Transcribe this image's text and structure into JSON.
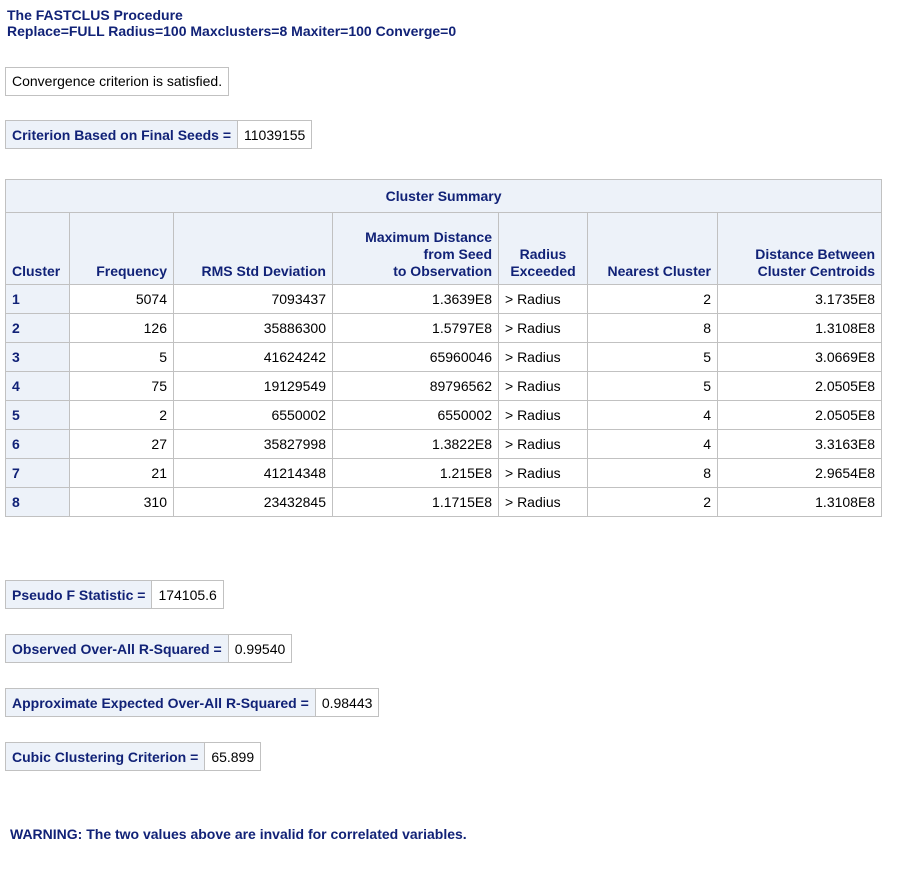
{
  "header": {
    "title": "The FASTCLUS Procedure",
    "options": "Replace=FULL Radius=100 Maxclusters=8 Maxiter=100 Converge=0"
  },
  "convergence_note": "Convergence criterion is satisfied.",
  "criterion_final_seeds": {
    "label": "Criterion Based on Final Seeds =",
    "value": "11039155"
  },
  "cluster_summary": {
    "caption": "Cluster Summary",
    "columns": [
      "Cluster",
      "Frequency",
      "RMS Std Deviation",
      "Maximum Distance\nfrom Seed\nto Observation",
      "Radius\nExceeded",
      "Nearest Cluster",
      "Distance Between\nCluster Centroids"
    ],
    "rows": [
      [
        "1",
        "5074",
        "7093437",
        "1.3639E8",
        "> Radius",
        "2",
        "3.1735E8"
      ],
      [
        "2",
        "126",
        "35886300",
        "1.5797E8",
        "> Radius",
        "8",
        "1.3108E8"
      ],
      [
        "3",
        "5",
        "41624242",
        "65960046",
        "> Radius",
        "5",
        "3.0669E8"
      ],
      [
        "4",
        "75",
        "19129549",
        "89796562",
        "> Radius",
        "5",
        "2.0505E8"
      ],
      [
        "5",
        "2",
        "6550002",
        "6550002",
        "> Radius",
        "4",
        "2.0505E8"
      ],
      [
        "6",
        "27",
        "35827998",
        "1.3822E8",
        "> Radius",
        "4",
        "3.3163E8"
      ],
      [
        "7",
        "21",
        "41214348",
        "1.215E8",
        "> Radius",
        "8",
        "2.9654E8"
      ],
      [
        "8",
        "310",
        "23432845",
        "1.1715E8",
        "> Radius",
        "2",
        "1.3108E8"
      ]
    ]
  },
  "stats": {
    "pseudo_f": {
      "label": "Pseudo F Statistic =",
      "value": "174105.6"
    },
    "observed_r2": {
      "label": "Observed Over-All R-Squared =",
      "value": "0.99540"
    },
    "expected_r2": {
      "label": "Approximate Expected Over-All R-Squared =",
      "value": "0.98443"
    },
    "ccc": {
      "label": "Cubic Clustering Criterion =",
      "value": "65.899"
    }
  },
  "warning": "WARNING: The two values above are invalid for correlated variables.",
  "colors": {
    "header_text": "#112277",
    "header_bg": "#edf2f9",
    "border": "#c1c1c1"
  }
}
